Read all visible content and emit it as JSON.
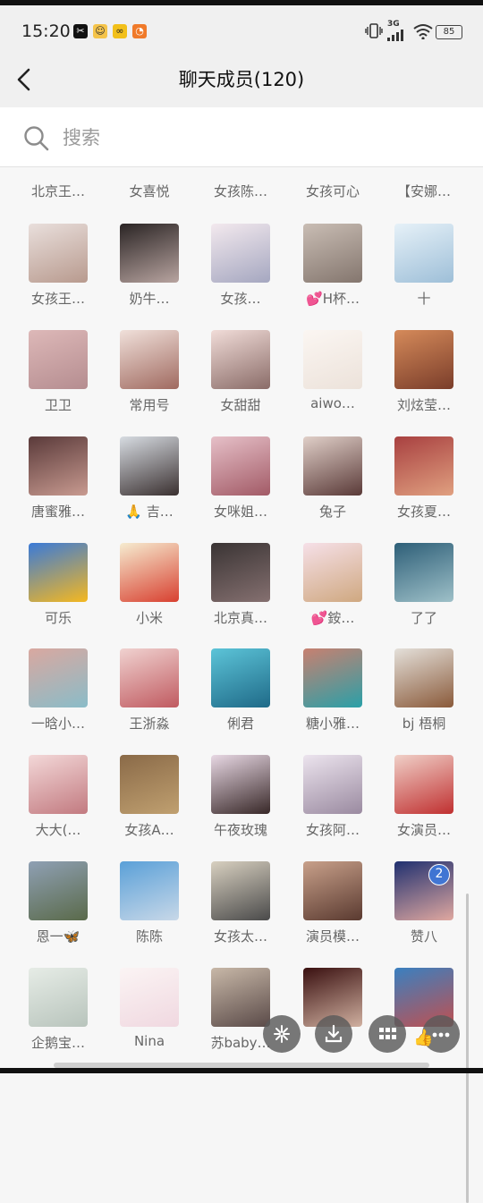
{
  "status_bar": {
    "time": "15:20",
    "app_icons": [
      {
        "name": "capcut-icon",
        "color": "#111111",
        "glyph": "✂"
      },
      {
        "name": "cat-app-icon",
        "color": "#f5c44a",
        "glyph": "☺"
      },
      {
        "name": "infinity-app-icon",
        "color": "#f2c01a",
        "glyph": "∞"
      },
      {
        "name": "orange-app-icon",
        "color": "#f07a2a",
        "glyph": "◔"
      }
    ],
    "network": "3G",
    "battery": "85"
  },
  "header": {
    "title": "聊天成员(120)"
  },
  "search": {
    "placeholder": "搜索"
  },
  "partial_row": [
    "北京王…",
    "女喜悦",
    "女孩陈…",
    "女孩可心",
    "【安娜…"
  ],
  "members": [
    {
      "name": "女孩王…",
      "c1": "#e9dfdc",
      "c2": "#b89a8e"
    },
    {
      "name": "奶牛…",
      "c1": "#2a2424",
      "c2": "#b8a4a0"
    },
    {
      "name": "女孩…",
      "c1": "#f3e9ee",
      "c2": "#a5a7c0"
    },
    {
      "name": "💕H杯…",
      "c1": "#c9bdb4",
      "c2": "#84766e"
    },
    {
      "name": "十",
      "c1": "#e6f1f8",
      "c2": "#9ebfd8",
      "badge": ""
    },
    {
      "name": "卫卫",
      "c1": "#ddb8b8",
      "c2": "#b58d90"
    },
    {
      "name": "常用号",
      "c1": "#f0e0da",
      "c2": "#a06a60"
    },
    {
      "name": "女甜甜",
      "c1": "#f1dcd8",
      "c2": "#8a6c68"
    },
    {
      "name": "aiwo…",
      "c1": "#fbf6f2",
      "c2": "#ece2da"
    },
    {
      "name": "刘炫莹…",
      "c1": "#d58a5a",
      "c2": "#7a3d2a"
    },
    {
      "name": "唐蜜雅…",
      "c1": "#5a3a3a",
      "c2": "#c89a90"
    },
    {
      "name": "🙏 吉…",
      "c1": "#d7dce2",
      "c2": "#3a3030"
    },
    {
      "name": "女咪姐…",
      "c1": "#e6c0c8",
      "c2": "#a25a66"
    },
    {
      "name": "兔子",
      "c1": "#e0cfc8",
      "c2": "#5a3a38"
    },
    {
      "name": "女孩夏…",
      "c1": "#a84040",
      "c2": "#e0a080"
    },
    {
      "name": "可乐",
      "c1": "#3a7ad8",
      "c2": "#f5b820"
    },
    {
      "name": "小米",
      "c1": "#f6ecd0",
      "c2": "#d84030"
    },
    {
      "name": "北京真…",
      "c1": "#3a3434",
      "c2": "#857070"
    },
    {
      "name": "💕銨…",
      "c1": "#f6e0e8",
      "c2": "#cfa880"
    },
    {
      "name": "了了",
      "c1": "#2e5f78",
      "c2": "#9ec0c8"
    },
    {
      "name": "一晗小…",
      "c1": "#d9a8a0",
      "c2": "#8abcc8"
    },
    {
      "name": "王浙淼",
      "c1": "#f0d2d0",
      "c2": "#c05a60"
    },
    {
      "name": "俐君",
      "c1": "#5cc4d8",
      "c2": "#1f6a88"
    },
    {
      "name": "糖小雅…",
      "c1": "#c88070",
      "c2": "#2aa0a8"
    },
    {
      "name": "bj  梧桐",
      "c1": "#e4e0da",
      "c2": "#8a5a3a"
    },
    {
      "name": "大大(…",
      "c1": "#f3d8d8",
      "c2": "#c27a80"
    },
    {
      "name": "女孩A…",
      "c1": "#8a6a48",
      "c2": "#c0a070"
    },
    {
      "name": "午夜玫瑰",
      "c1": "#e8d8e4",
      "c2": "#382828"
    },
    {
      "name": "女孩阿…",
      "c1": "#ece4ee",
      "c2": "#9a8aa0"
    },
    {
      "name": "女演员…",
      "c1": "#f0d0c8",
      "c2": "#c03030"
    },
    {
      "name": "恩一🦋",
      "c1": "#8fa0b4",
      "c2": "#5a6a4a"
    },
    {
      "name": "陈陈",
      "c1": "#5aa0d8",
      "c2": "#c8d8e8"
    },
    {
      "name": "女孩太…",
      "c1": "#d8d0c0",
      "c2": "#4a4a4a"
    },
    {
      "name": "演员模…",
      "c1": "#c8a08a",
      "c2": "#5a3a30"
    },
    {
      "name": "赞八",
      "c1": "#203070",
      "c2": "#e0a8a0",
      "badge": "2"
    },
    {
      "name": "企鹅宝…",
      "c1": "#e6ece6",
      "c2": "#b8c4bc"
    },
    {
      "name": "Nina",
      "c1": "#fbf4f4",
      "c2": "#f0d8e0"
    },
    {
      "name": "苏baby…",
      "c1": "#c8b8a8",
      "c2": "#5a4a48"
    },
    {
      "name": "",
      "c1": "#3a1010",
      "c2": "#d0b0a0"
    },
    {
      "name": "",
      "c1": "#3a80c0",
      "c2": "#c05050"
    }
  ],
  "fab_buttons": [
    {
      "name": "shortcut-fab",
      "icon": "sparkle"
    },
    {
      "name": "download-fab",
      "icon": "download"
    },
    {
      "name": "grid-fab",
      "icon": "grid"
    },
    {
      "name": "more-fab",
      "icon": "more"
    }
  ]
}
